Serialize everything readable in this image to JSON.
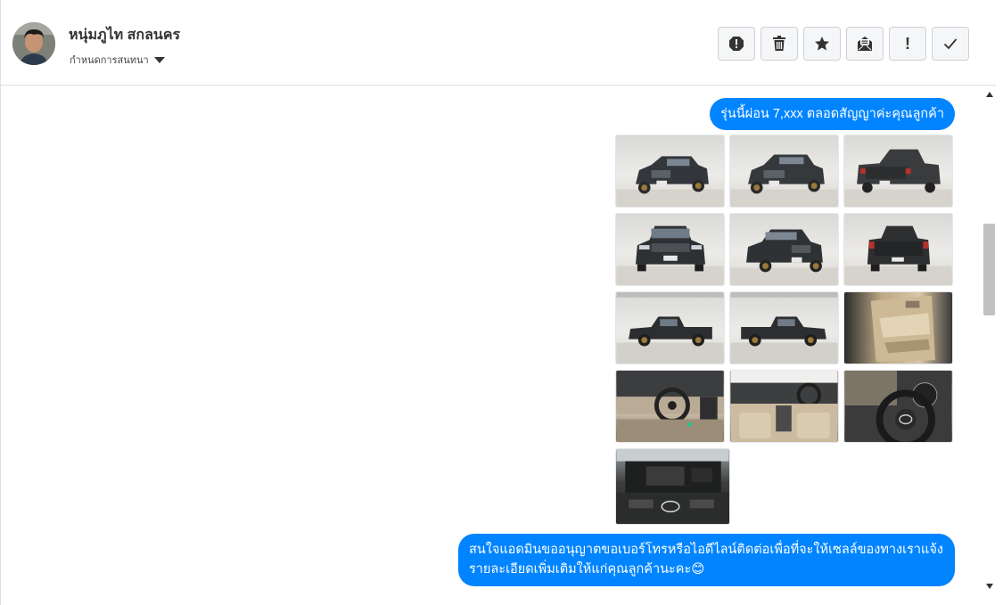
{
  "contact": {
    "name": "หนุ่มภูไท สกลนคร",
    "assign_label": "กำหนดการสนทนา"
  },
  "toolbar": {
    "buttons": [
      {
        "icon": "alert-circle-icon"
      },
      {
        "icon": "trash-icon"
      },
      {
        "icon": "star-icon"
      },
      {
        "icon": "mail-open-icon"
      },
      {
        "icon": "exclamation-icon",
        "glyph": "!"
      },
      {
        "icon": "check-icon"
      }
    ]
  },
  "messages": [
    {
      "text": "รุ่นนี้ผ่อน 7,xxx ตลอดสัญญาค่ะคุณลูกค้า"
    },
    {
      "text": "สนใจแอดมินขออนุญาตขอเบอร์โทรหรือไอดีไลน์ติดต่อเพื่อที่จะให้เซลล์ของทางเราแจ้งรายละเอียดเพิ่มเติมให้แก่คุณลูกค้านะคะ😊"
    }
  ],
  "photos": [
    {
      "kind": "studio",
      "subject": "front-left"
    },
    {
      "kind": "studio",
      "subject": "front-left"
    },
    {
      "kind": "studio",
      "subject": "rear"
    },
    {
      "kind": "studio",
      "subject": "front"
    },
    {
      "kind": "studio",
      "subject": "front-left"
    },
    {
      "kind": "studio",
      "subject": "rear"
    },
    {
      "kind": "studio",
      "subject": "side"
    },
    {
      "kind": "studio",
      "subject": "side"
    },
    {
      "kind": "door",
      "subject": "door-panel"
    },
    {
      "kind": "interior",
      "subject": "dashboard"
    },
    {
      "kind": "interior",
      "subject": "cabin"
    },
    {
      "kind": "interior",
      "subject": "steering-wheel"
    },
    {
      "kind": "engine",
      "subject": "engine-bay"
    }
  ],
  "colors": {
    "bubble": "#0084ff",
    "border": "#dddfe2"
  }
}
